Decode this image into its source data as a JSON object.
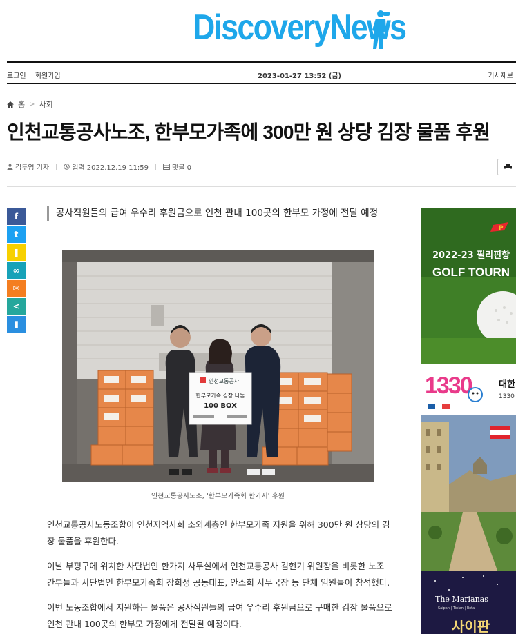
{
  "header": {
    "logo_text": "DiscoveryNews",
    "login": "로그인",
    "signup": "회원가입",
    "date": "2023-01-27 13:52 (금)",
    "submit_article": "기사제보"
  },
  "breadcrumb": {
    "home": "홈",
    "section": "사회"
  },
  "article": {
    "headline": "인천교통공사노조, 한부모가족에 300만 원 상당 김장 물품 후원",
    "author": "김두영 기자",
    "published": "입력 2022.12.19 11:59",
    "comments": "댓글 0",
    "subtitle": "공사직원들의 급여 우수리 후원금으로 인천 관내 100곳의 한부모 가정에 전달 예정",
    "photo_sign_org": "인천교통공사",
    "photo_sign_line1": "한부모가족 김장 나눔",
    "photo_sign_line2": "100 BOX",
    "photo_caption": "인천교통공사노조, '한부모가족회 한가지' 후원",
    "paragraphs": [
      "인천교통공사노동조합이 인천지역사회 소외계층인 한부모가족 지원을 위해 300만 원 상당의 김장 물품을 후원한다.",
      "이날 부평구에 위치한 사단법인 한가지 사무실에서 인천교통공사 김현기 위원장을 비롯한 노조 간부들과 사단법인 한부모가족회 장희정 공동대표, 안소희 사무국장 등 단체 임원들이 참석했다.",
      "이번 노동조합에서 지원하는 물품은 공사직원들의 급여 우수리 후원금으로 구매한 김장 물품으로 인천 관내 100곳의 한부모 가정에게 전달될 예정이다."
    ]
  },
  "social": [
    {
      "name": "facebook",
      "glyph": "f",
      "color": "#3b5998"
    },
    {
      "name": "twitter",
      "glyph": "t",
      "color": "#1da1f2"
    },
    {
      "name": "kakaostory",
      "glyph": "❚",
      "color": "#f7d000"
    },
    {
      "name": "link",
      "glyph": "∞",
      "color": "#17a2b8"
    },
    {
      "name": "email",
      "glyph": "✉",
      "color": "#f47e20"
    },
    {
      "name": "share",
      "glyph": "<",
      "color": "#25a79c"
    },
    {
      "name": "bookmark",
      "glyph": "▮",
      "color": "#2a8fe0"
    }
  ],
  "ads": {
    "golf_line1": "2022-23 필리핀항",
    "golf_line2": "GOLF TOURN",
    "golf_logo": "P",
    "tour_number": "1330",
    "tour_title": "대한",
    "tour_sub": "1330",
    "marianas_title": "The Marianas",
    "marianas_sub": "Saipan | Tinian | Rota",
    "marianas_korean": "사이판"
  }
}
